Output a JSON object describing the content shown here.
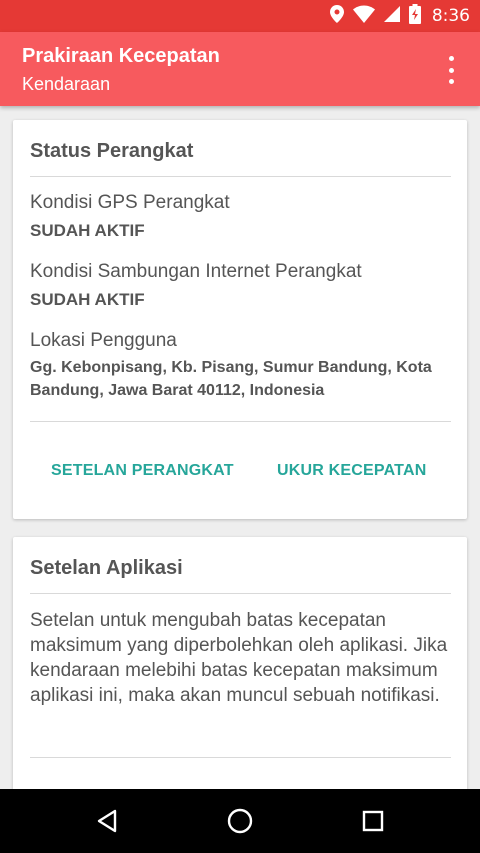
{
  "status_bar": {
    "time": "8:36"
  },
  "app_bar": {
    "title": "Prakiraan Kecepatan",
    "subtitle": "Kendaraan"
  },
  "device_status": {
    "title": "Status Perangkat",
    "gps_label": "Kondisi GPS Perangkat",
    "gps_value": "SUDAH AKTIF",
    "internet_label": "Kondisi Sambungan Internet Perangkat",
    "internet_value": "SUDAH AKTIF",
    "location_label": "Lokasi Pengguna",
    "location_value": "Gg. Kebonpisang, Kb. Pisang, Sumur Bandung, Kota Bandung, Jawa Barat 40112, Indonesia",
    "settings_button": "SETELAN PERANGKAT",
    "measure_button": "UKUR KECEPATAN"
  },
  "app_settings": {
    "title": "Setelan Aplikasi",
    "description": "Setelan untuk mengubah batas kecepatan maksimum yang diperbolehkan oleh aplikasi. Jika kendaraan melebihi batas kecepatan maksimum aplikasi ini, maka akan muncul sebuah notifikasi."
  },
  "colors": {
    "status_bar": "#e53935",
    "app_bar": "#f75a5e",
    "accent": "#26a69a"
  }
}
